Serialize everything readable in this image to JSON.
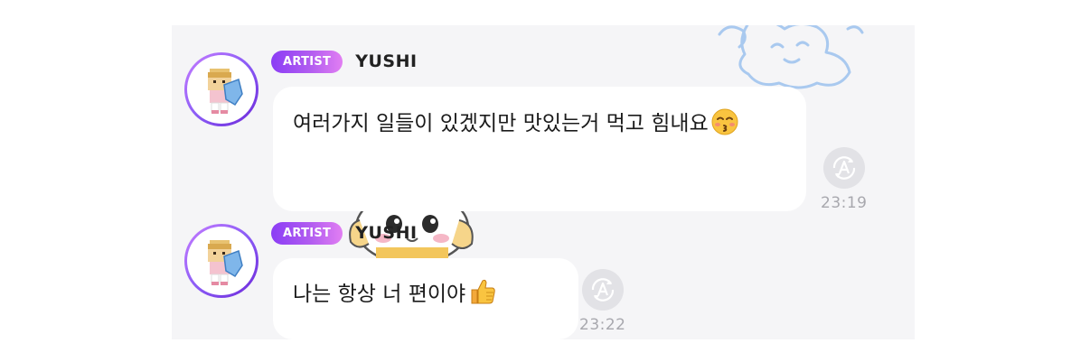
{
  "messages": [
    {
      "badge": "ARTIST",
      "sender": "YUSHI",
      "text": "여러가지 일들이 있겠지만 맛있는거 먹고 힘내요",
      "emoji_icon": "kissing-face-smiling-eyes-emoji",
      "time": "23:19",
      "action_icon": "translate-icon"
    },
    {
      "badge": "ARTIST",
      "sender": "YUSHI",
      "text": "나는 항상 너 편이야",
      "emoji_icon": "thumbs-up-emoji",
      "time": "23:22",
      "action_icon": "translate-icon"
    }
  ],
  "colors": {
    "badge_gradient_start": "#8b3df5",
    "badge_gradient_end": "#e17ef2",
    "chat_background": "#f5f5f7",
    "bubble": "#ffffff",
    "timestamp": "#a8a8ae"
  }
}
